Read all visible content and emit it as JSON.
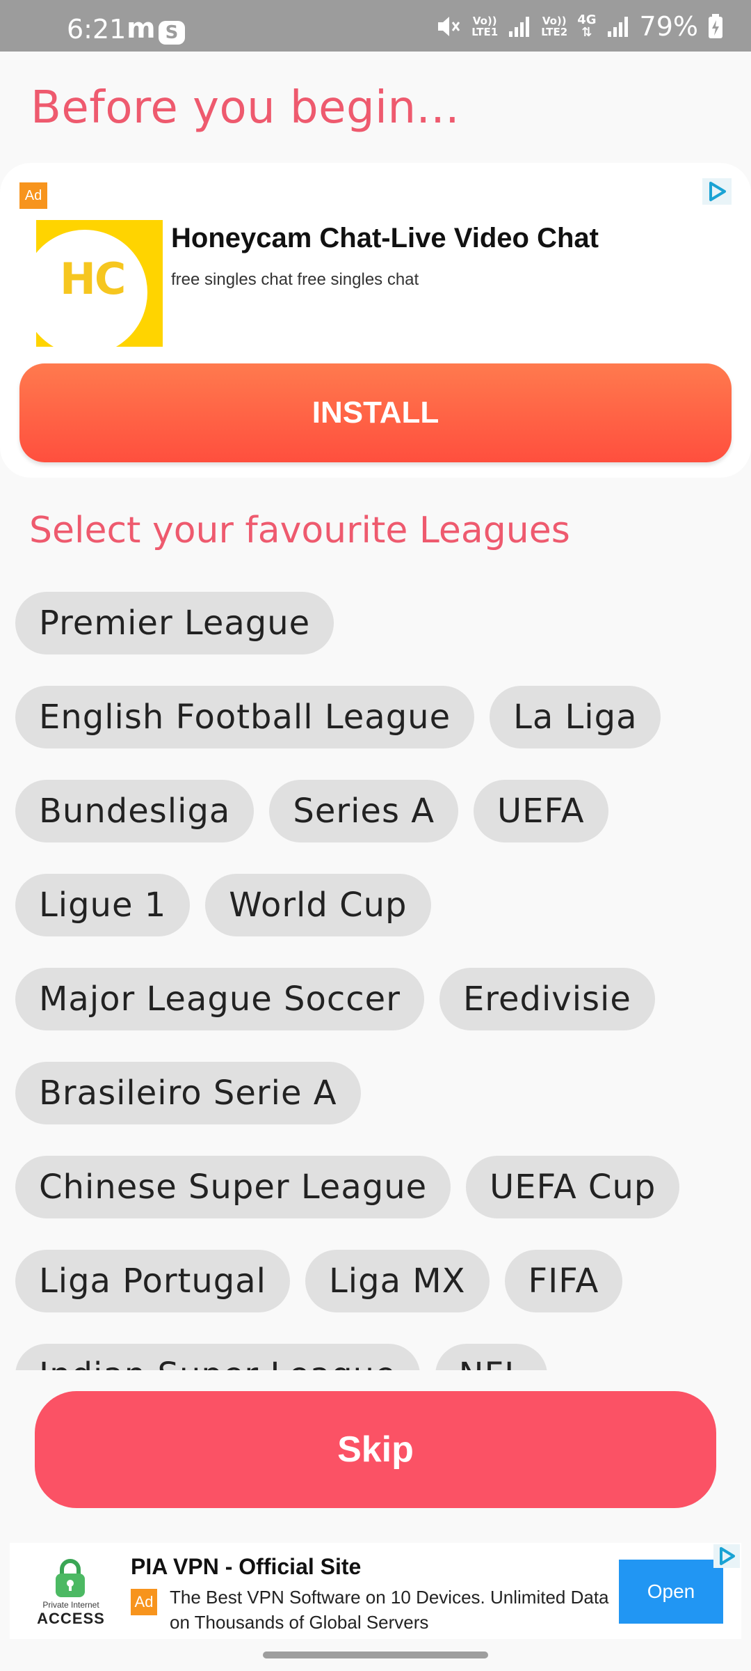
{
  "status_bar": {
    "time": "6:21",
    "app_m": "m",
    "app_s": "S",
    "lte1": "LTE1",
    "lte2": "LTE2",
    "volte": "Vo))",
    "network": "4G",
    "battery": "79%"
  },
  "page": {
    "title": "Before you begin...",
    "section_title": "Select your favourite Leagues"
  },
  "ad_top": {
    "badge": "Ad",
    "logo_text": "HC",
    "title": "Honeycam Chat-Live Video Chat",
    "subtitle": "free singles chat free singles chat",
    "install_label": "INSTALL"
  },
  "leagues": [
    [
      "Premier League"
    ],
    [
      "English Football League",
      "La Liga"
    ],
    [
      "Bundesliga",
      "Series A",
      "UEFA"
    ],
    [
      "Ligue 1",
      "World Cup"
    ],
    [
      "Major League Soccer",
      "Eredivisie"
    ],
    [
      "Brasileiro Serie A"
    ],
    [
      "Chinese Super League",
      "UEFA Cup"
    ],
    [
      "Liga Portugal",
      "Liga MX",
      "FIFA"
    ],
    [
      "Indian Super League",
      "NFL"
    ]
  ],
  "skip_label": "Skip",
  "ad_bottom": {
    "logo_small": "Private Internet",
    "logo_brand": "ACCESS",
    "title": "PIA VPN - Official Site",
    "badge": "Ad",
    "description": "The Best VPN Software on 10 Devices. Unlimited Data on Thousands of Global Servers",
    "open_label": "Open"
  },
  "colors": {
    "accent": "#ee5a6e",
    "skip": "#fb5265",
    "install_top": "#ff7a4e",
    "install_bottom": "#ff4f3e",
    "open": "#2196f3"
  }
}
